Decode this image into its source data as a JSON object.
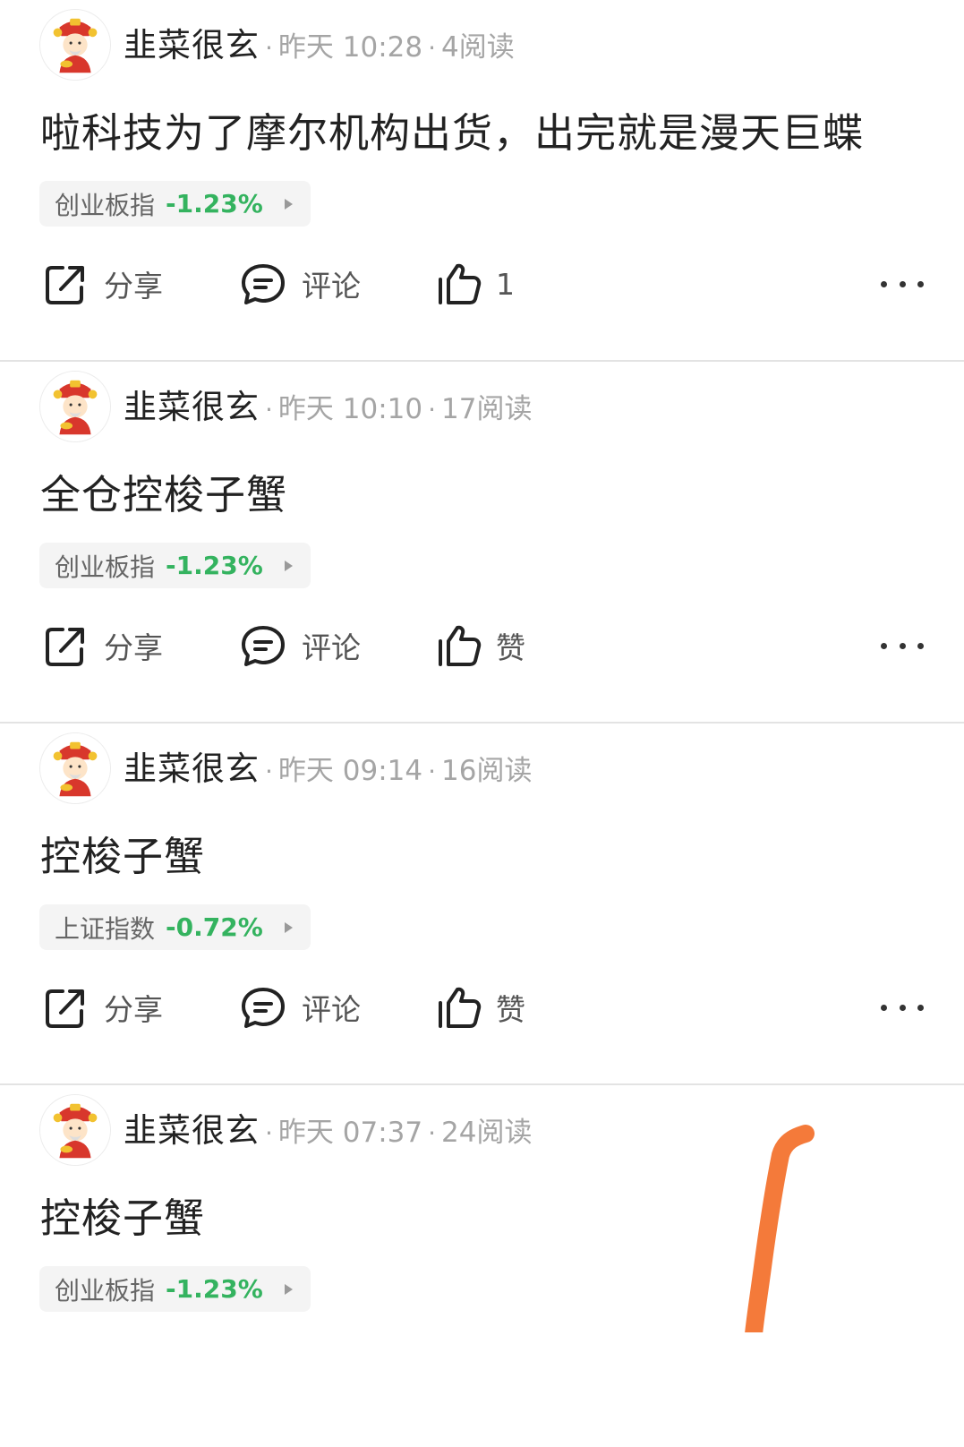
{
  "posts": [
    {
      "author": "韭菜很玄",
      "time": "昨天 10:28",
      "reads": "4阅读",
      "content": "啦科技为了摩尔机构出货，出完就是漫天巨蝶",
      "tag": {
        "name": "创业板指",
        "change": "-1.23%"
      },
      "share_label": "分享",
      "comment_label": "评论",
      "like_label": "1"
    },
    {
      "author": "韭菜很玄",
      "time": "昨天 10:10",
      "reads": "17阅读",
      "content": "全仓控梭子蟹",
      "tag": {
        "name": "创业板指",
        "change": "-1.23%"
      },
      "share_label": "分享",
      "comment_label": "评论",
      "like_label": "赞"
    },
    {
      "author": "韭菜很玄",
      "time": "昨天 09:14",
      "reads": "16阅读",
      "content": "控梭子蟹",
      "tag": {
        "name": "上证指数",
        "change": "-0.72%"
      },
      "share_label": "分享",
      "comment_label": "评论",
      "like_label": "赞"
    },
    {
      "author": "韭菜很玄",
      "time": "昨天 07:37",
      "reads": "24阅读",
      "content": "控梭子蟹",
      "tag": {
        "name": "创业板指",
        "change": "-1.23%"
      }
    }
  ],
  "separator": "·",
  "colors": {
    "negative_change": "#34b35f",
    "meta_text": "#a5a5a5",
    "scribble": "#f47a3a"
  },
  "icons": {
    "share": "share-icon",
    "comment": "comment-icon",
    "like": "thumbs-up-icon",
    "more": "more-icon",
    "avatar": "fortune-god-avatar"
  }
}
